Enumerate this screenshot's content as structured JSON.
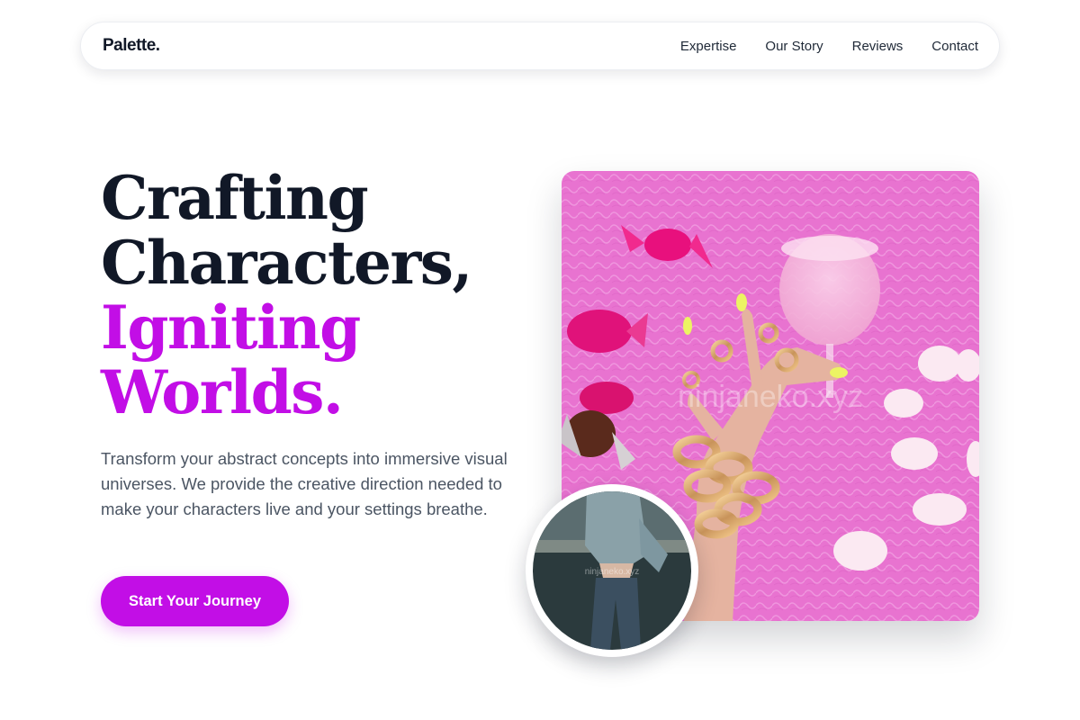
{
  "nav": {
    "brand": "Palette.",
    "links": [
      "Expertise",
      "Our Story",
      "Reviews",
      "Contact"
    ]
  },
  "hero": {
    "headline_lines": [
      "Crafting",
      "Characters,",
      "Igniting",
      "Worlds."
    ],
    "lede": "Transform your abstract concepts into immersive visual universes. We provide the creative direction needed to make your characters live and your settings breathe.",
    "cta_label": "Start Your Journey",
    "main_image": {
      "watermark": "ninjaneko.xyz"
    },
    "avatar_image": {
      "watermark": "ninjaneko.xyz"
    }
  },
  "colors": {
    "accent": "#c20ee6",
    "heading": "#111827",
    "body_text": "#4b5563",
    "image_background": "#e873d0"
  }
}
